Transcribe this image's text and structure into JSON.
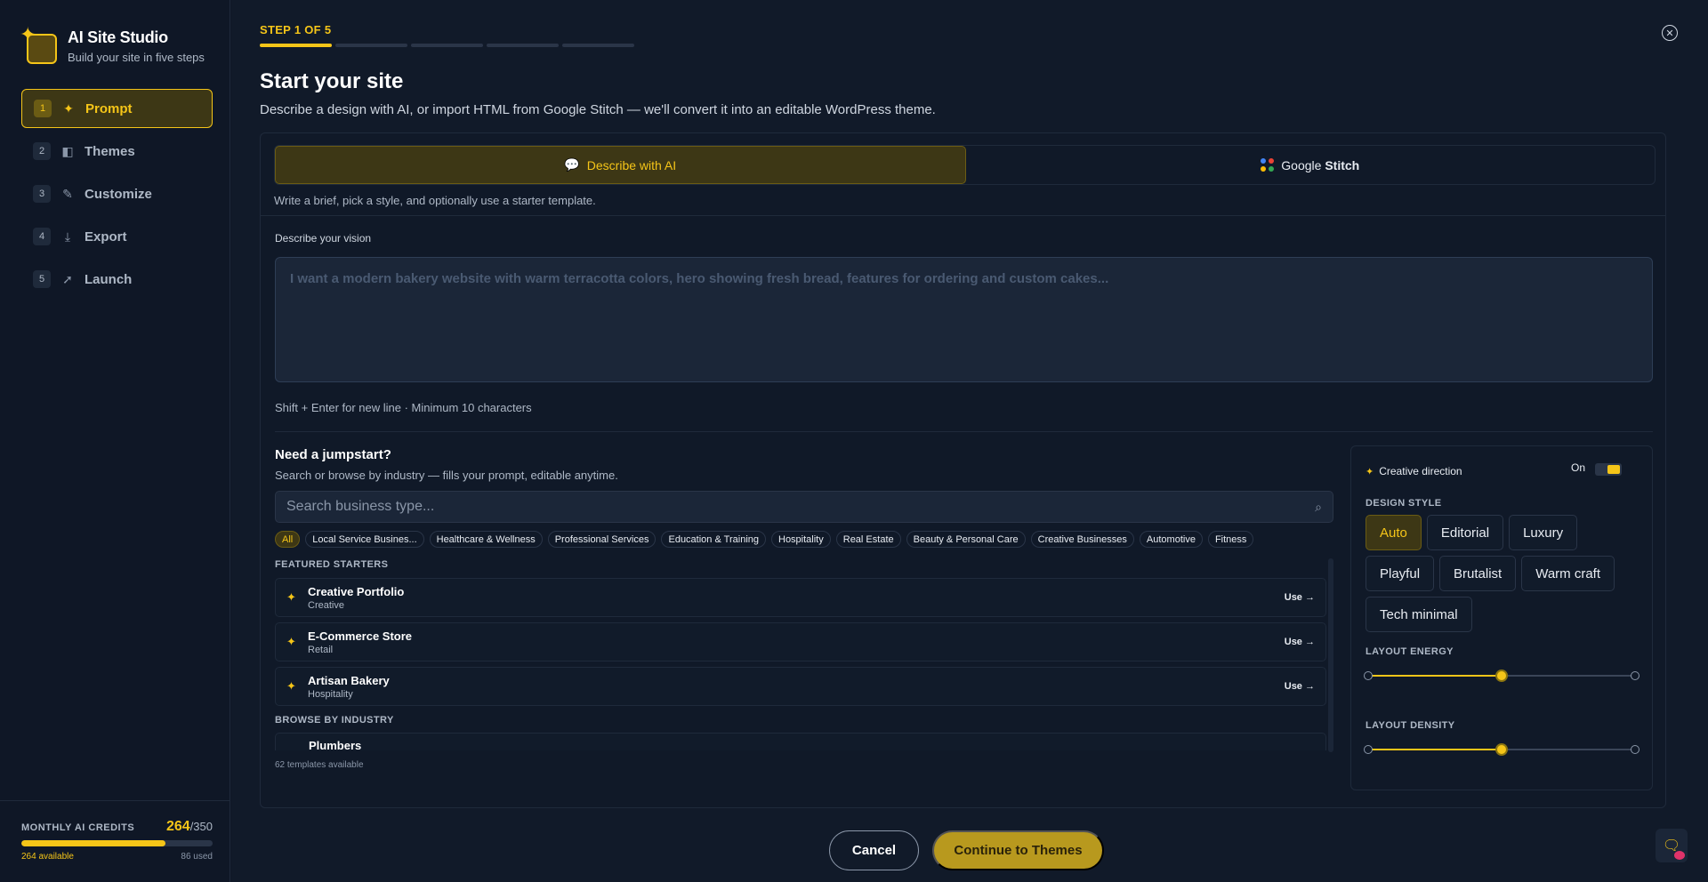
{
  "app": {
    "title": "AI Site Studio",
    "subtitle": "Build your site in five steps"
  },
  "steps": [
    {
      "num": "1",
      "label": "Prompt",
      "icon": "sparkles-icon",
      "active": true
    },
    {
      "num": "2",
      "label": "Themes",
      "icon": "swatches-icon",
      "active": false
    },
    {
      "num": "3",
      "label": "Customize",
      "icon": "brush-icon",
      "active": false
    },
    {
      "num": "4",
      "label": "Export",
      "icon": "download-icon",
      "active": false
    },
    {
      "num": "5",
      "label": "Launch",
      "icon": "rocket-icon",
      "active": false
    }
  ],
  "credits": {
    "label": "MONTHLY AI CREDITS",
    "used_value": "264",
    "total": "/350",
    "available": "264 available",
    "used": "86 used",
    "fill_fraction": 0.754
  },
  "wizard": {
    "step_indicator": "STEP 1 OF 5",
    "progress_total": 5,
    "progress_current": 1,
    "title": "Start your site",
    "subtitle": "Describe a design with AI, or import HTML from Google Stitch — we'll convert it into an editable WordPress theme."
  },
  "tabs": {
    "describe": "Describe with AI",
    "stitch_prefix": "Google ",
    "stitch_strong": "Stitch",
    "hint": "Write a brief, pick a style, and optionally use a starter template."
  },
  "vision": {
    "label": "Describe your vision",
    "placeholder": "I want a modern bakery website with warm terracotta colors, hero showing fresh bread, features for ordering and custom cakes...",
    "hint": "Shift + Enter for new line · Minimum 10 characters"
  },
  "jumpstart": {
    "title": "Need a jumpstart?",
    "subtitle": "Search or browse by industry — fills your prompt, editable anytime.",
    "search_placeholder": "Search business type...",
    "chips": [
      "All",
      "Local Service Busines...",
      "Healthcare & Wellness",
      "Professional Services",
      "Education & Training",
      "Hospitality",
      "Real Estate",
      "Beauty & Personal Care",
      "Creative Businesses",
      "Automotive",
      "Fitness"
    ],
    "featured_label": "FEATURED STARTERS",
    "featured": [
      {
        "name": "Creative Portfolio",
        "category": "Creative",
        "action": "Use"
      },
      {
        "name": "E-Commerce Store",
        "category": "Retail",
        "action": "Use"
      },
      {
        "name": "Artisan Bakery",
        "category": "Hospitality",
        "action": "Use"
      }
    ],
    "industry_label": "BROWSE BY INDUSTRY",
    "industry_first": "Plumbers",
    "templates_count": "62 templates available"
  },
  "creative": {
    "label": "Creative direction",
    "toggle_label": "On",
    "toggle_on": true,
    "design_style_label": "DESIGN STYLE",
    "styles": [
      "Auto",
      "Editorial",
      "Luxury",
      "Playful",
      "Brutalist",
      "Warm craft",
      "Tech minimal"
    ],
    "selected_style": "Auto",
    "layout_energy_label": "LAYOUT ENERGY",
    "layout_energy": 0.5,
    "layout_density_label": "LAYOUT DENSITY",
    "layout_density": 0.5
  },
  "footer": {
    "cancel": "Cancel",
    "continue": "Continue to Themes"
  },
  "colors": {
    "accent": "#f5c518",
    "background": "#0f1726"
  }
}
